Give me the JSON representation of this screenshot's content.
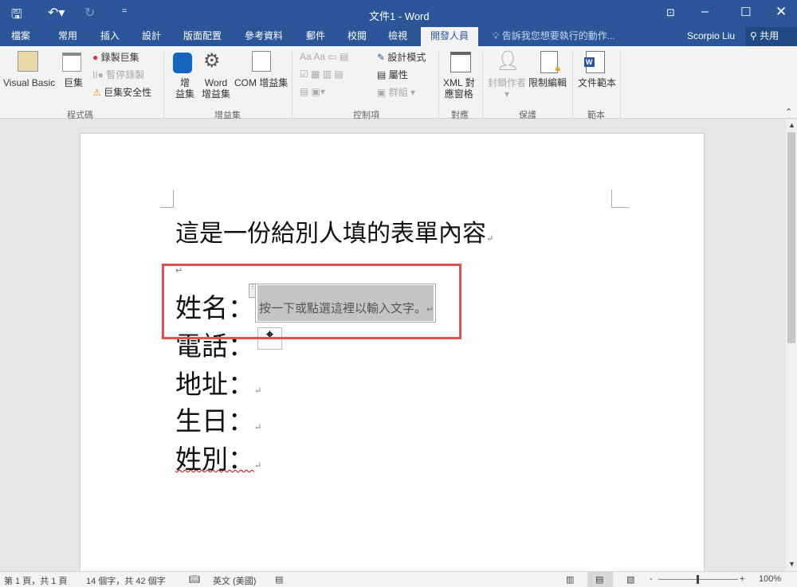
{
  "titlebar": {
    "title": "文件1 - Word"
  },
  "tabs": [
    "檔案",
    "常用",
    "插入",
    "設計",
    "版面配置",
    "參考資料",
    "郵件",
    "校閱",
    "檢視",
    "開發人員"
  ],
  "tell_me": "告訴我您想要執行的動作...",
  "user": "Scorpio Liu",
  "share": "共用",
  "ribbon": {
    "code": {
      "label": "程式碼",
      "visual_basic": "Visual Basic",
      "macros": "巨集",
      "record": "錄製巨集",
      "pause": "暫停錄製",
      "security": "巨集安全性"
    },
    "addins": {
      "label": "增益集",
      "addins_a": "增",
      "addins_b": "益集",
      "word_a": "Word",
      "word_b": "增益集",
      "com": "COM 增益集"
    },
    "controls": {
      "label": "控制項",
      "design": "設計模式",
      "properties": "屬性",
      "group": "群組"
    },
    "mapping": {
      "label": "對應",
      "xml_a": "XML 對",
      "xml_b": "應窗格"
    },
    "protect": {
      "label": "保護",
      "block": "封鎖作者",
      "restrict": "限制編輯"
    },
    "templates": {
      "label": "範本",
      "doc_template": "文件範本"
    }
  },
  "document": {
    "heading": "這是一份給別人填的表單內容",
    "fields": [
      "姓名：",
      "電話：",
      "地址：",
      "生日：",
      "姓別："
    ],
    "placeholder": "按一下或點選這裡以輸入文字。"
  },
  "status": {
    "page": "第 1 頁，共 1 頁",
    "words": "14 個字，共 42 個字",
    "language": "英文 (美國)",
    "zoom": "100%"
  }
}
